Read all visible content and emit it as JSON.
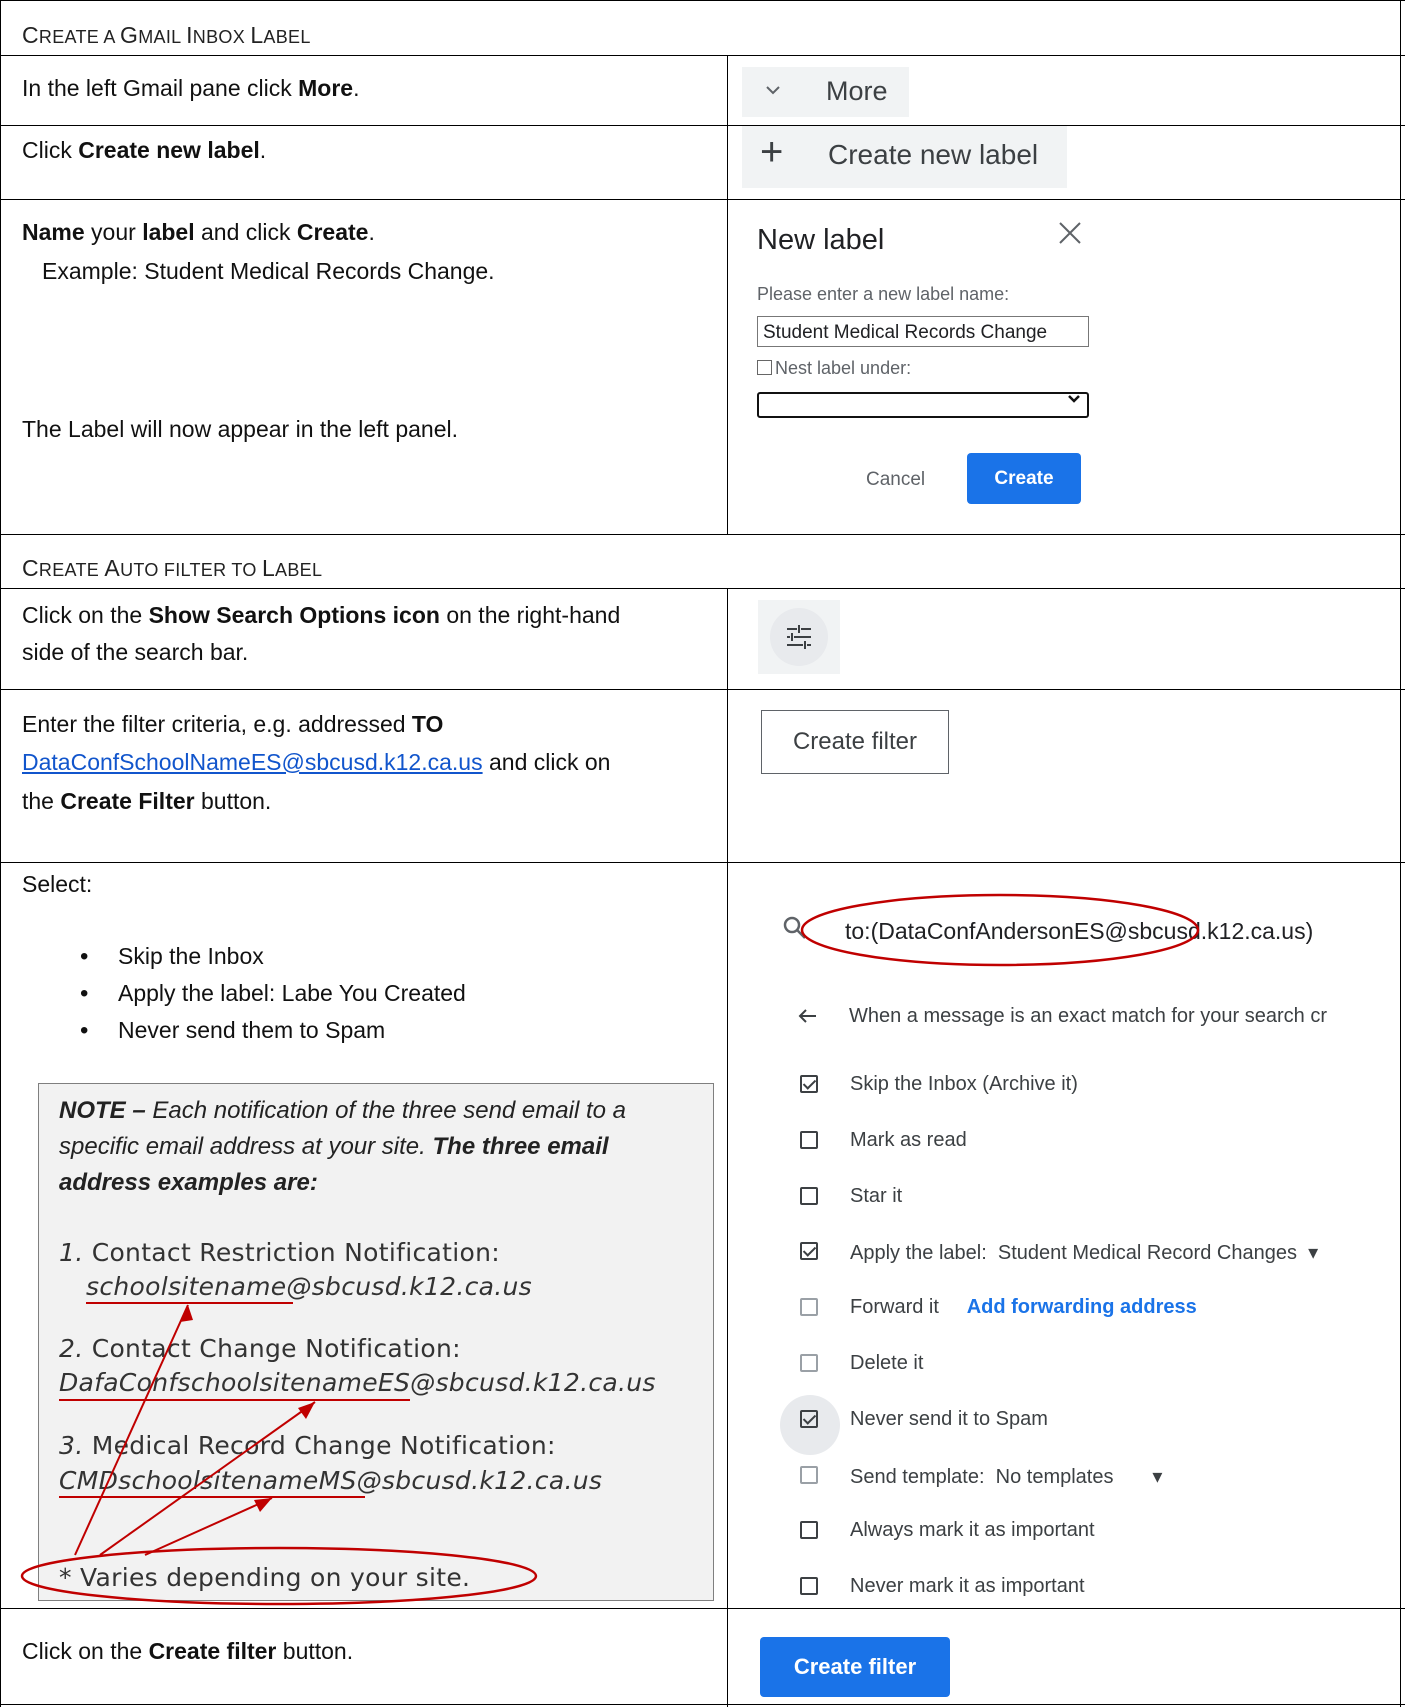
{
  "section1": {
    "title_parts": [
      "C",
      "REATE A ",
      "G",
      "MAIL ",
      "I",
      "NBOX ",
      "L",
      "ABEL"
    ]
  },
  "section2": {
    "title_parts": [
      "C",
      "REATE ",
      "A",
      "UTO FILTER TO ",
      "L",
      "ABEL"
    ]
  },
  "rows": {
    "more": {
      "prefix": "In the left Gmail pane click ",
      "bold": "More",
      "suffix": "."
    },
    "newlabel": {
      "prefix": "Click ",
      "bold": "Create new label",
      "suffix": "."
    },
    "name": {
      "b1": "Name",
      "t1": " your ",
      "b2": "label",
      "t2": " and click ",
      "b3": "Create",
      "t3": ".",
      "example": "Example: Student Medical Records Change.",
      "appear": "The Label will now appear in the left panel."
    },
    "search": {
      "prefix": "Click on the ",
      "bold": "Show Search Options icon",
      "suffix": " on the right-hand",
      "line2": "side of the search bar."
    },
    "criteria": {
      "prefix": "Enter the filter criteria, e.g. addressed ",
      "bold": "TO",
      "link": "DataConfSchoolNameES@sbcusd.k12.ca.us",
      "after_link": " and click on",
      "line3_prefix": "the ",
      "line3_bold": "Create Filter",
      "line3_suffix": " button."
    },
    "select": {
      "label": "Select:",
      "bullets": [
        "Skip the Inbox",
        "Apply the label: Labe You Created",
        "Never send them to Spam"
      ]
    },
    "final": {
      "prefix": "Click on the ",
      "bold": "Create filter",
      "suffix": " button."
    }
  },
  "note": {
    "bold_lead": "NOTE –",
    "text1": " Each notification of the three send email to a",
    "line2_text": "specific email address at your site.",
    "line2_bold": " The three email",
    "line3_bold": "address examples are:",
    "items": [
      {
        "num": "1.",
        "label": " Contact Restriction Notification:",
        "email": "schoolsitename@sbcusd.k12.ca.us"
      },
      {
        "num": "2.",
        "label": " Contact Change Notification:",
        "email": "DafaConfschoolsitenameES@sbcusd.k12.ca.us"
      },
      {
        "num": "3.",
        "label": " Medical Record Change Notification:",
        "email": "CMDschoolsitenameMS@sbcusd.k12.ca.us"
      }
    ],
    "varies": "* Varies depending on your site."
  },
  "gmail": {
    "more_label": "More",
    "new_label_button": "Create new label",
    "dialog": {
      "title": "New label",
      "prompt": "Please enter a new label name:",
      "input_value": "Student Medical Records Change",
      "nest_label": "Nest label under:",
      "cancel": "Cancel",
      "create": "Create"
    },
    "create_filter_outline": "Create filter",
    "filter": {
      "search_query": "to:(DataConfAndersonES@sbcusd.k12.ca.us)",
      "description": "When a message is an exact match for your search cr",
      "options": [
        {
          "label": "Skip the Inbox (Archive it)",
          "checked": true
        },
        {
          "label": "Mark as read",
          "checked": false
        },
        {
          "label": "Star it",
          "checked": false
        },
        {
          "label": "Apply the label:",
          "value": "Student Medical Record Changes",
          "checked": true
        },
        {
          "label": "Forward it",
          "link": "Add forwarding address",
          "checked": false
        },
        {
          "label": "Delete it",
          "checked": false
        },
        {
          "label": "Never send it to Spam",
          "checked": true
        },
        {
          "label": "Send template:",
          "value": "No templates",
          "checked": false
        },
        {
          "label": "Always mark it as important",
          "checked": false
        },
        {
          "label": "Never mark it as important",
          "checked": false
        }
      ]
    },
    "create_filter_blue": "Create filter"
  },
  "colors": {
    "accent": "#1a73e8",
    "annotation": "#c00000",
    "note_bg": "#f2f2f2"
  },
  "icons": [
    "chevron-down-icon",
    "plus-icon",
    "close-icon",
    "tune-icon",
    "search-icon",
    "arrow-back-icon",
    "dropdown-arrow-icon"
  ]
}
